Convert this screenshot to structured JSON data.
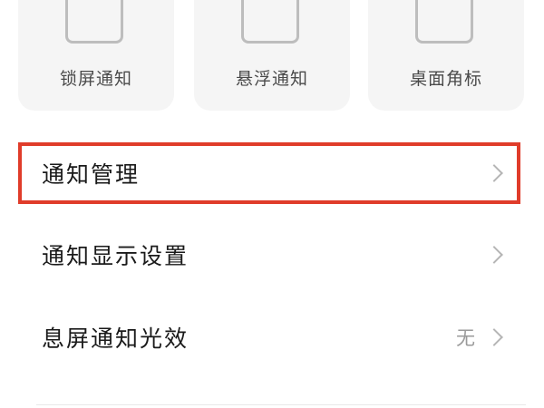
{
  "cards": [
    {
      "label": "锁屏通知",
      "icon": "lock-screen-phone-icon"
    },
    {
      "label": "悬浮通知",
      "icon": "floating-notification-phone-icon"
    },
    {
      "label": "桌面角标",
      "icon": "desktop-badge-phone-icon"
    }
  ],
  "settings": [
    {
      "label": "通知管理",
      "value": ""
    },
    {
      "label": "通知显示设置",
      "value": ""
    },
    {
      "label": "息屏通知光效",
      "value": "无"
    }
  ],
  "highlight_color": "#e03c2a"
}
